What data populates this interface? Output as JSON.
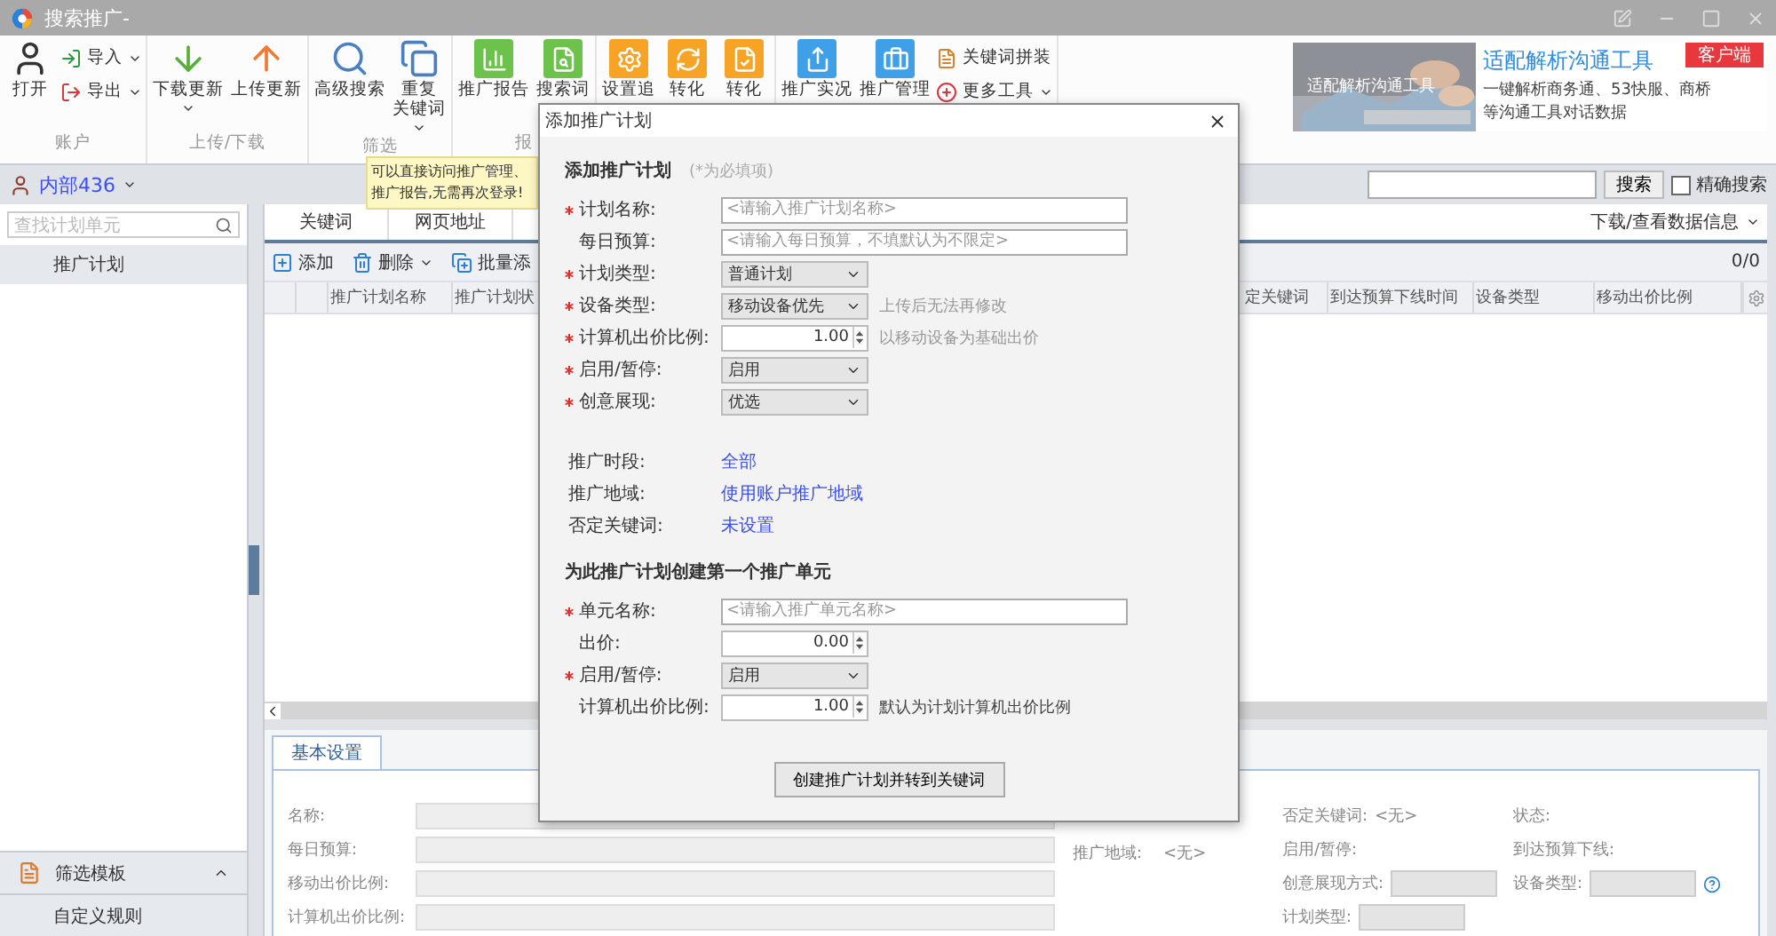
{
  "window": {
    "title": "搜索推广-"
  },
  "ribbon": {
    "groups": [
      {
        "label": "账户",
        "items": [
          {
            "kind": "large",
            "label": "打开",
            "caret": false
          },
          {
            "kind": "small",
            "label": "导入",
            "caret": true
          },
          {
            "kind": "small",
            "label": "导出",
            "caret": true
          }
        ]
      },
      {
        "label": "上传/下载",
        "items": [
          {
            "kind": "large",
            "label": "下载更新",
            "caret": true
          },
          {
            "kind": "large",
            "label": "上传更新",
            "caret": false
          }
        ]
      },
      {
        "label": "筛选",
        "items": [
          {
            "kind": "large",
            "label": "高级搜索",
            "caret": false
          },
          {
            "kind": "large",
            "lines": [
              "重复",
              "关键词"
            ],
            "caret": true
          }
        ]
      },
      {
        "label": "报",
        "items": [
          {
            "kind": "large",
            "label": "推广报告",
            "caret": false
          },
          {
            "kind": "large",
            "label": "搜索词",
            "caret": false
          }
        ]
      },
      {
        "items": [
          {
            "kind": "large",
            "label": "设置追",
            "caret": false
          },
          {
            "kind": "large",
            "label": "转化",
            "caret": false
          },
          {
            "kind": "large",
            "label": "转化",
            "caret": false
          }
        ]
      },
      {
        "items": [
          {
            "kind": "large",
            "label": "推广实况",
            "caret": false
          },
          {
            "kind": "large",
            "label": "推广管理",
            "caret": false
          },
          {
            "kind": "small",
            "label": "关键词拼装",
            "caret": false
          },
          {
            "kind": "small",
            "label": "更多工具",
            "caret": true
          }
        ]
      }
    ]
  },
  "ad": {
    "image_text": "适配解析沟通工具",
    "title": "适配解析沟通工具",
    "badge": "客户端",
    "description": "一键解析商务通、53快服、商桥等沟通工具对话数据"
  },
  "tooltip": [
    "可以直接访问推广管理、",
    "推广报告,无需再次登录!"
  ],
  "account": {
    "name": "内部436",
    "search_button": "搜索",
    "exact": {
      "label": "精确搜索",
      "checked": false
    }
  },
  "sidebar": {
    "search_placeholder": "查找计划单元",
    "items": [
      {
        "label": "推广计划",
        "selected": true
      }
    ],
    "footer_title": "筛选模板",
    "footer_items": [
      "自定义规则"
    ]
  },
  "tabs": [
    {
      "label": "关键词",
      "selected": false
    },
    {
      "label": "网页地址",
      "selected": false
    }
  ],
  "data_menu": "下载/查看数据信息",
  "tools": [
    {
      "label": "添加",
      "caret": false
    },
    {
      "label": "删除",
      "caret": true
    },
    {
      "label": "批量添",
      "caret": false
    }
  ],
  "count": "0/0",
  "table": {
    "columns_left": [
      "推广计划名称",
      "推广计划状"
    ],
    "columns_right": [
      "定关键词",
      "到达预算下线时间",
      "设备类型",
      "移动出价比例"
    ]
  },
  "details": {
    "tabs": [
      {
        "label": "基本设置",
        "selected": true
      }
    ],
    "fields": [
      "名称:",
      "每日预算:",
      "移动出价比例:",
      "计算机出价比例:"
    ],
    "region": {
      "label": "推广地域:",
      "value": "<无>"
    },
    "side": [
      {
        "kind": "value",
        "label": "否定关键词:",
        "value": "<无>"
      },
      {
        "kind": "label",
        "label": "状态:"
      },
      {
        "kind": "label",
        "label": "启用/暂停:"
      },
      {
        "kind": "label",
        "label": "到达预算下线:"
      },
      {
        "kind": "select",
        "label": "创意展现方式:"
      },
      {
        "kind": "select",
        "label": "设备类型:"
      },
      {
        "kind": "select",
        "label": "计划类型:"
      }
    ]
  },
  "dialog": {
    "title": "添加推广计划",
    "heading": "添加推广计划",
    "note": "(*为必填项)",
    "plan_fields": [
      {
        "kind": "text",
        "label": "计划名称:",
        "required": true,
        "placeholder": "<请输入推广计划名称>"
      },
      {
        "kind": "text",
        "label": "每日预算:",
        "required": false,
        "placeholder": "<请输入每日预算，不填默认为不限定>"
      },
      {
        "kind": "select",
        "label": "计划类型:",
        "required": true,
        "value": "普通计划"
      },
      {
        "kind": "select",
        "label": "设备类型:",
        "required": true,
        "value": "移动设备优先",
        "hint": "上传后无法再修改"
      },
      {
        "kind": "spin",
        "label": "计算机出价比例:",
        "required": true,
        "value": "1.00",
        "hint": "以移动设备为基础出价"
      },
      {
        "kind": "select",
        "label": "启用/暂停:",
        "required": true,
        "value": "启用"
      },
      {
        "kind": "select",
        "label": "创意展现:",
        "required": true,
        "value": "优选"
      }
    ],
    "settings": [
      {
        "label": "推广时段:",
        "link": "全部"
      },
      {
        "label": "推广地域:",
        "link": "使用账户推广地域"
      },
      {
        "label": "否定关键词:",
        "link": "未设置"
      }
    ],
    "unit_heading": "为此推广计划创建第一个推广单元",
    "unit_fields": [
      {
        "kind": "text",
        "label": "单元名称:",
        "required": true,
        "placeholder": "<请输入推广单元名称>"
      },
      {
        "kind": "spin",
        "label": "出价:",
        "required": false,
        "value": "0.00"
      },
      {
        "kind": "select",
        "label": "启用/暂停:",
        "required": true,
        "value": "启用"
      },
      {
        "kind": "spin",
        "label": "计算机出价比例:",
        "required": false,
        "value": "1.00",
        "hint": "默认为计划计算机出价比例"
      }
    ],
    "submit": "创建推广计划并转到关键词"
  }
}
